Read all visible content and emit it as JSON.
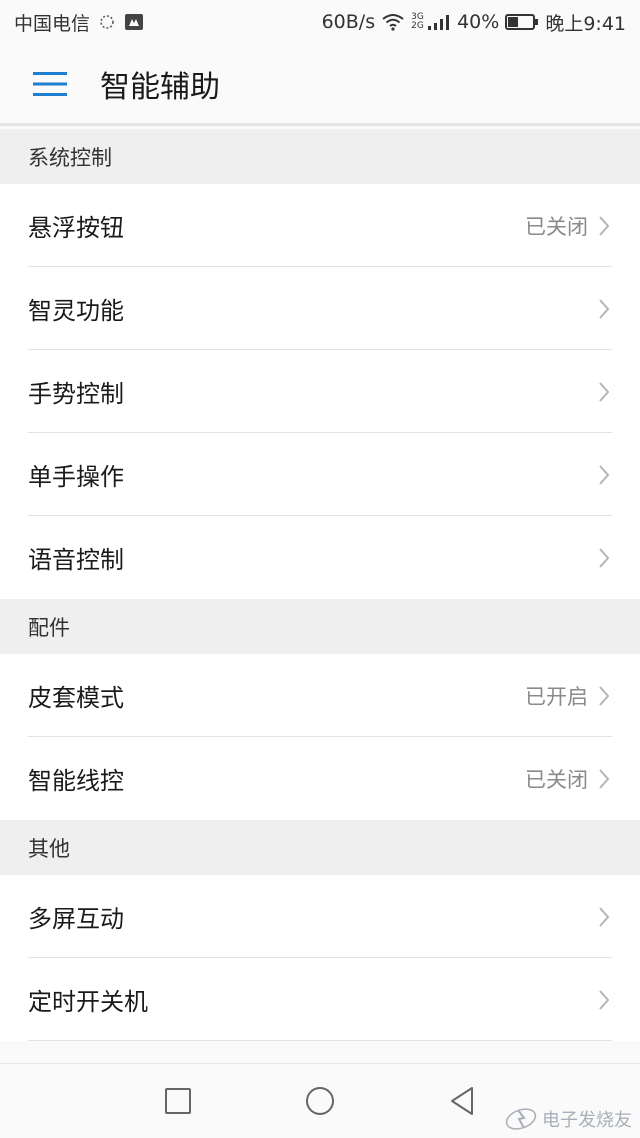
{
  "status_bar": {
    "carrier": "中国电信",
    "net_speed": "60B/s",
    "network_type": "3G 2G",
    "battery": "40%",
    "time": "晚上9:41"
  },
  "app_bar": {
    "title": "智能辅助"
  },
  "sections": [
    {
      "title": "系统控制",
      "items": [
        {
          "label": "悬浮按钮",
          "value": "已关闭"
        },
        {
          "label": "智灵功能",
          "value": ""
        },
        {
          "label": "手势控制",
          "value": ""
        },
        {
          "label": "单手操作",
          "value": ""
        },
        {
          "label": "语音控制",
          "value": ""
        }
      ]
    },
    {
      "title": "配件",
      "items": [
        {
          "label": "皮套模式",
          "value": "已开启"
        },
        {
          "label": "智能线控",
          "value": "已关闭"
        }
      ]
    },
    {
      "title": "其他",
      "items": [
        {
          "label": "多屏互动",
          "value": ""
        },
        {
          "label": "定时开关机",
          "value": ""
        }
      ]
    }
  ],
  "watermark": "电子发烧友",
  "colors": {
    "accent": "#1e7fd1",
    "secondary_text": "#8a8a8a"
  }
}
